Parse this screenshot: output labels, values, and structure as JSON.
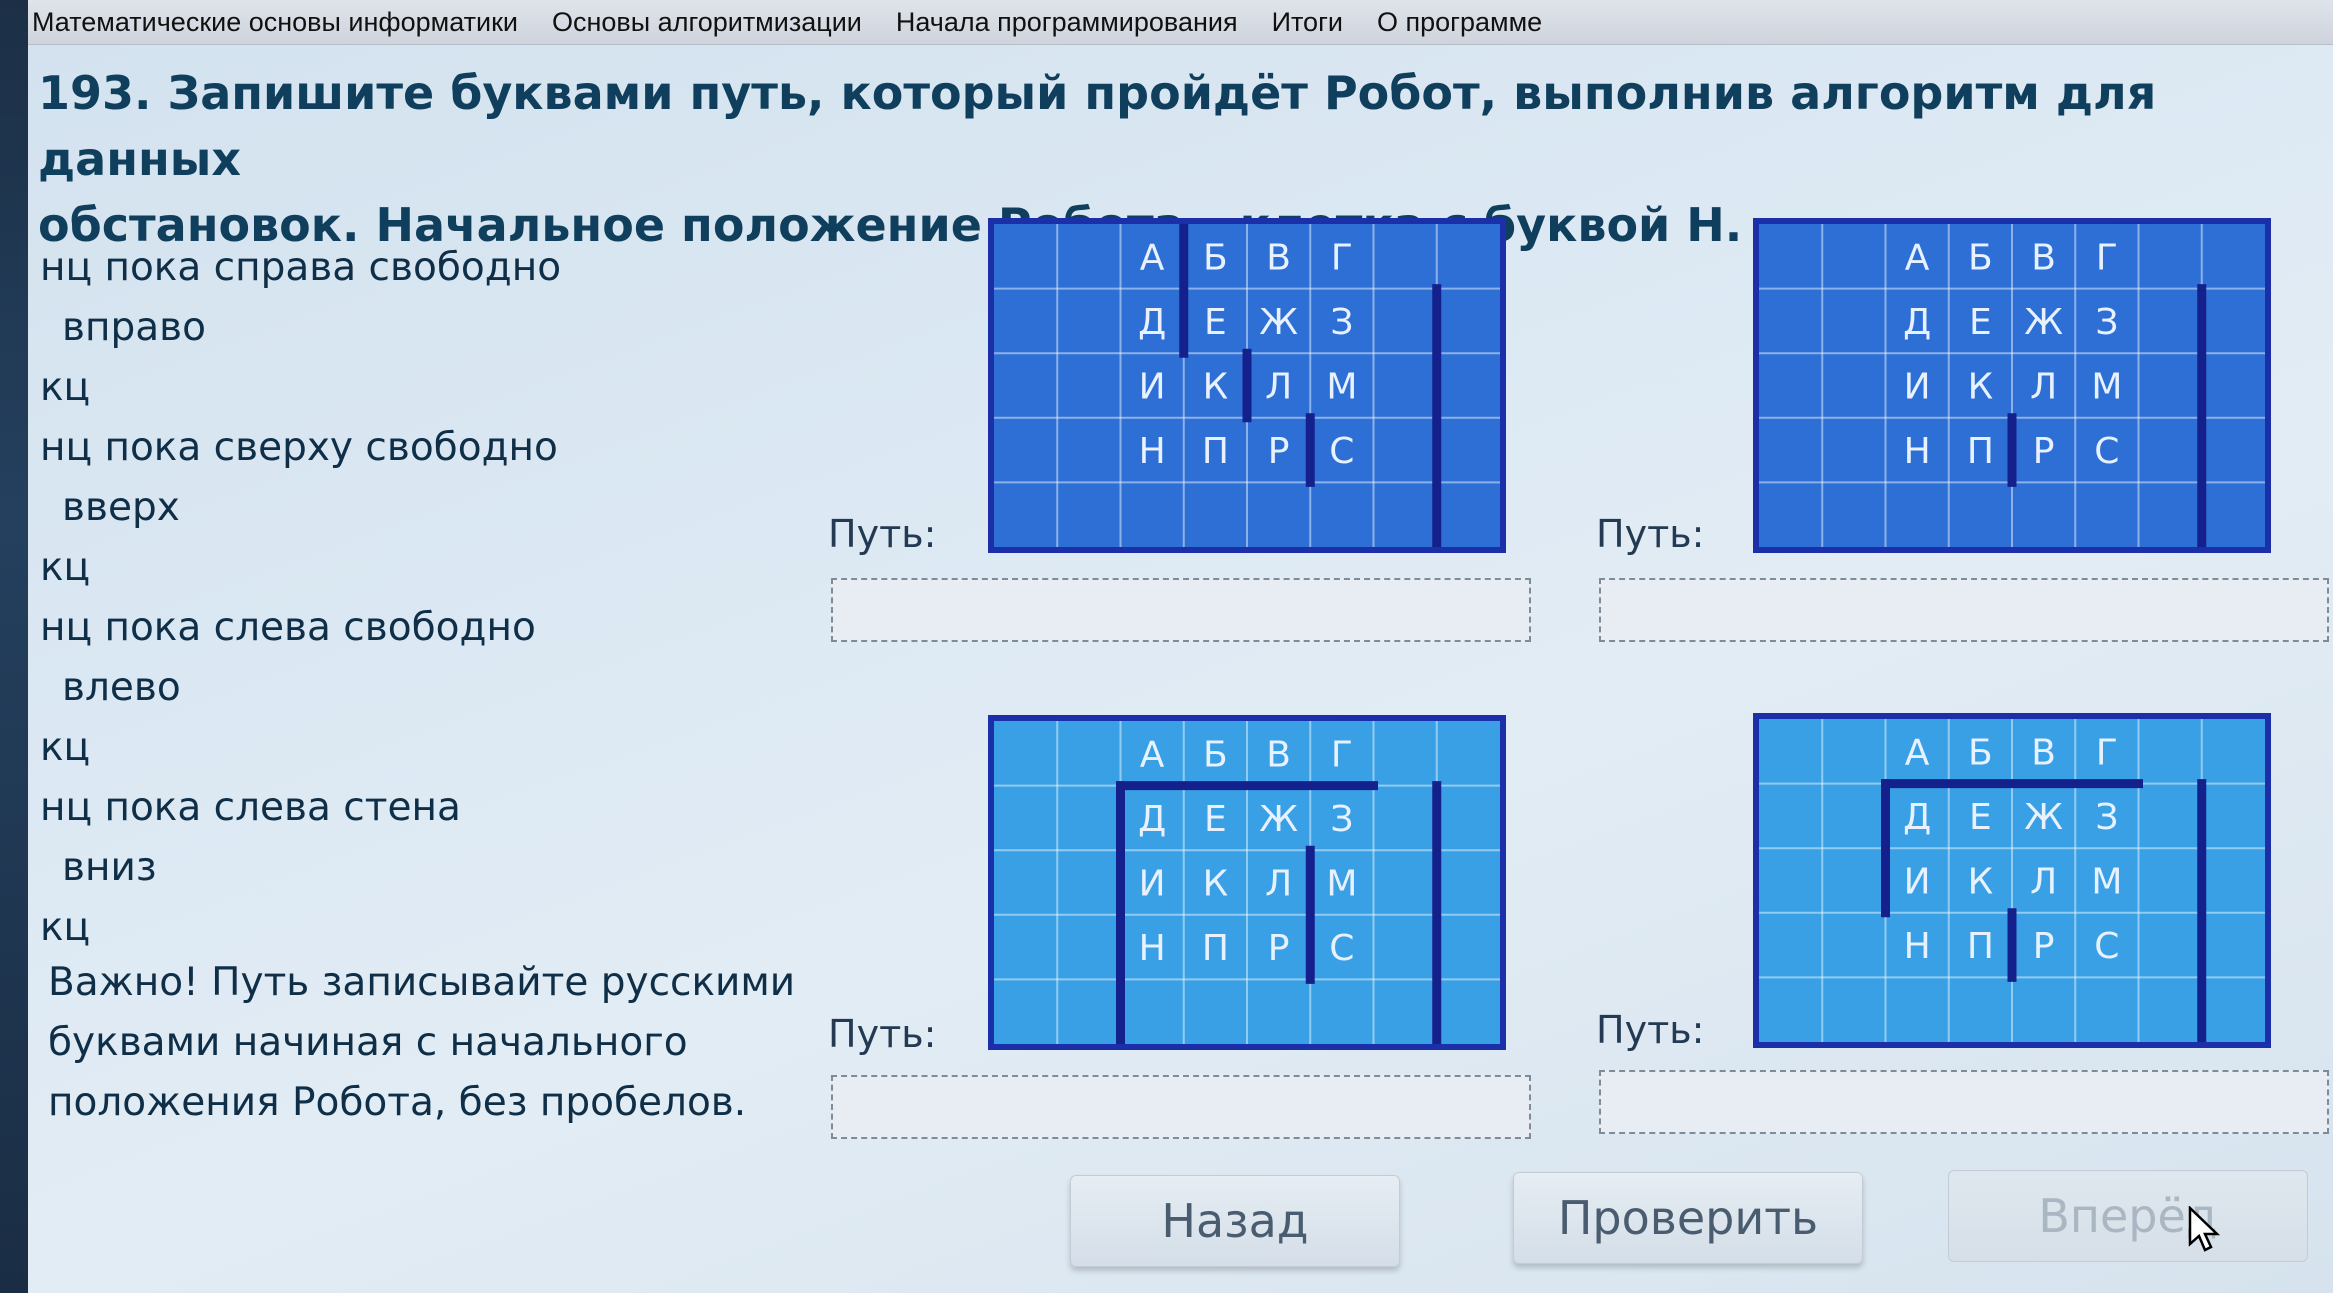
{
  "menu": [
    "Математические основы информатики",
    "Основы алгоритмизации",
    "Начала программирования",
    "Итоги",
    "О программе"
  ],
  "task": {
    "title_line1": "193. Запишите буквами путь, который пройдёт Робот, выполнив алгоритм для данных",
    "title_line2": "обстановок. Начальное положение Робота – клетка с буквой Н."
  },
  "algorithm": [
    {
      "text": "нц пока справа свободно",
      "indent": false
    },
    {
      "text": "вправо",
      "indent": true
    },
    {
      "text": "кц",
      "indent": false
    },
    {
      "text": "нц пока сверху свободно",
      "indent": false
    },
    {
      "text": "вверх",
      "indent": true
    },
    {
      "text": "кц",
      "indent": false
    },
    {
      "text": "нц пока слева свободно",
      "indent": false
    },
    {
      "text": "влево",
      "indent": true
    },
    {
      "text": "кц",
      "indent": false
    },
    {
      "text": "нц пока слева стена",
      "indent": false
    },
    {
      "text": "вниз",
      "indent": true
    },
    {
      "text": "кц",
      "indent": false
    }
  ],
  "note": [
    "Важно! Путь записывайте русскими",
    "буквами начиная с начального",
    "положения Робота, без пробелов."
  ],
  "grid_letters": [
    [
      "А",
      "Б",
      "В",
      "Г"
    ],
    [
      "Д",
      "Е",
      "Ж",
      "З"
    ],
    [
      "И",
      "К",
      "Л",
      "М"
    ],
    [
      "Н",
      "П",
      "Р",
      "С"
    ]
  ],
  "colors": {
    "board_border": "#1a2fa8",
    "board_dark": "#2e6fd6",
    "board_light": "#3aa0e6",
    "wall": "#14208c",
    "letter": "#e8f1ff"
  },
  "path_label": "Путь:",
  "boards": [
    {
      "name": "board-1",
      "shade": "dark",
      "path_value": ""
    },
    {
      "name": "board-2",
      "shade": "dark",
      "path_value": ""
    },
    {
      "name": "board-3",
      "shade": "light",
      "path_value": ""
    },
    {
      "name": "board-4",
      "shade": "light",
      "path_value": ""
    }
  ],
  "buttons": {
    "back": "Назад",
    "check": "Проверить",
    "forward": "Вперёд"
  }
}
